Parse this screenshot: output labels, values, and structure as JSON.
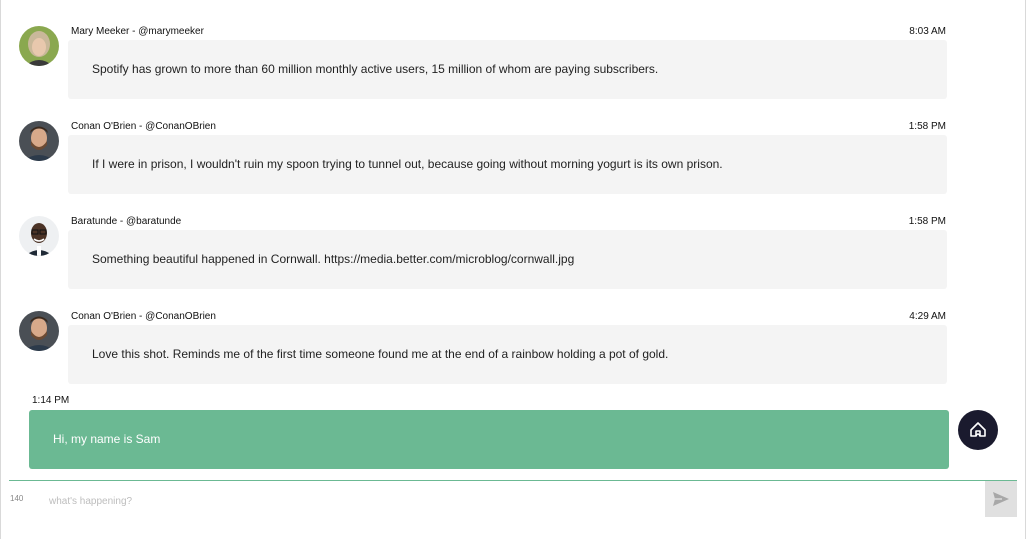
{
  "messages": [
    {
      "author": "Mary Meeker - @marymeeker",
      "time": "8:03 AM",
      "text": "Spotify has grown to more than 60 million monthly active users, 15 million of whom are paying subscribers.",
      "avatar": "woman-gray-hair"
    },
    {
      "author": "Conan O'Brien - @ConanOBrien",
      "time": "1:58 PM",
      "text": "If I were in prison, I wouldn't ruin my spoon trying to tunnel out, because going without morning yogurt is its own prison.",
      "avatar": "man-beard"
    },
    {
      "author": "Baratunde - @baratunde",
      "time": "1:58 PM",
      "text": "Something beautiful happened in Cornwall. https://media.better.com/microblog/cornwall.jpg",
      "avatar": "man-glasses-smile"
    },
    {
      "author": "Conan O'Brien - @ConanOBrien",
      "time": "4:29 AM",
      "text": "Love this shot. Reminds me of the first time someone found me at the end of a rainbow holding a pot of gold.",
      "avatar": "man-beard"
    }
  ],
  "my_message": {
    "time": "1:14 PM",
    "text": "Hi, my name is Sam"
  },
  "fab": {
    "icon": "home-logo-icon"
  },
  "composer": {
    "counter": "140",
    "placeholder": "what's happening?",
    "value": "",
    "send_icon": "send-icon"
  },
  "colors": {
    "accent": "#6bb993",
    "bubble": "#f4f4f4",
    "fab": "#1a1a2e"
  }
}
